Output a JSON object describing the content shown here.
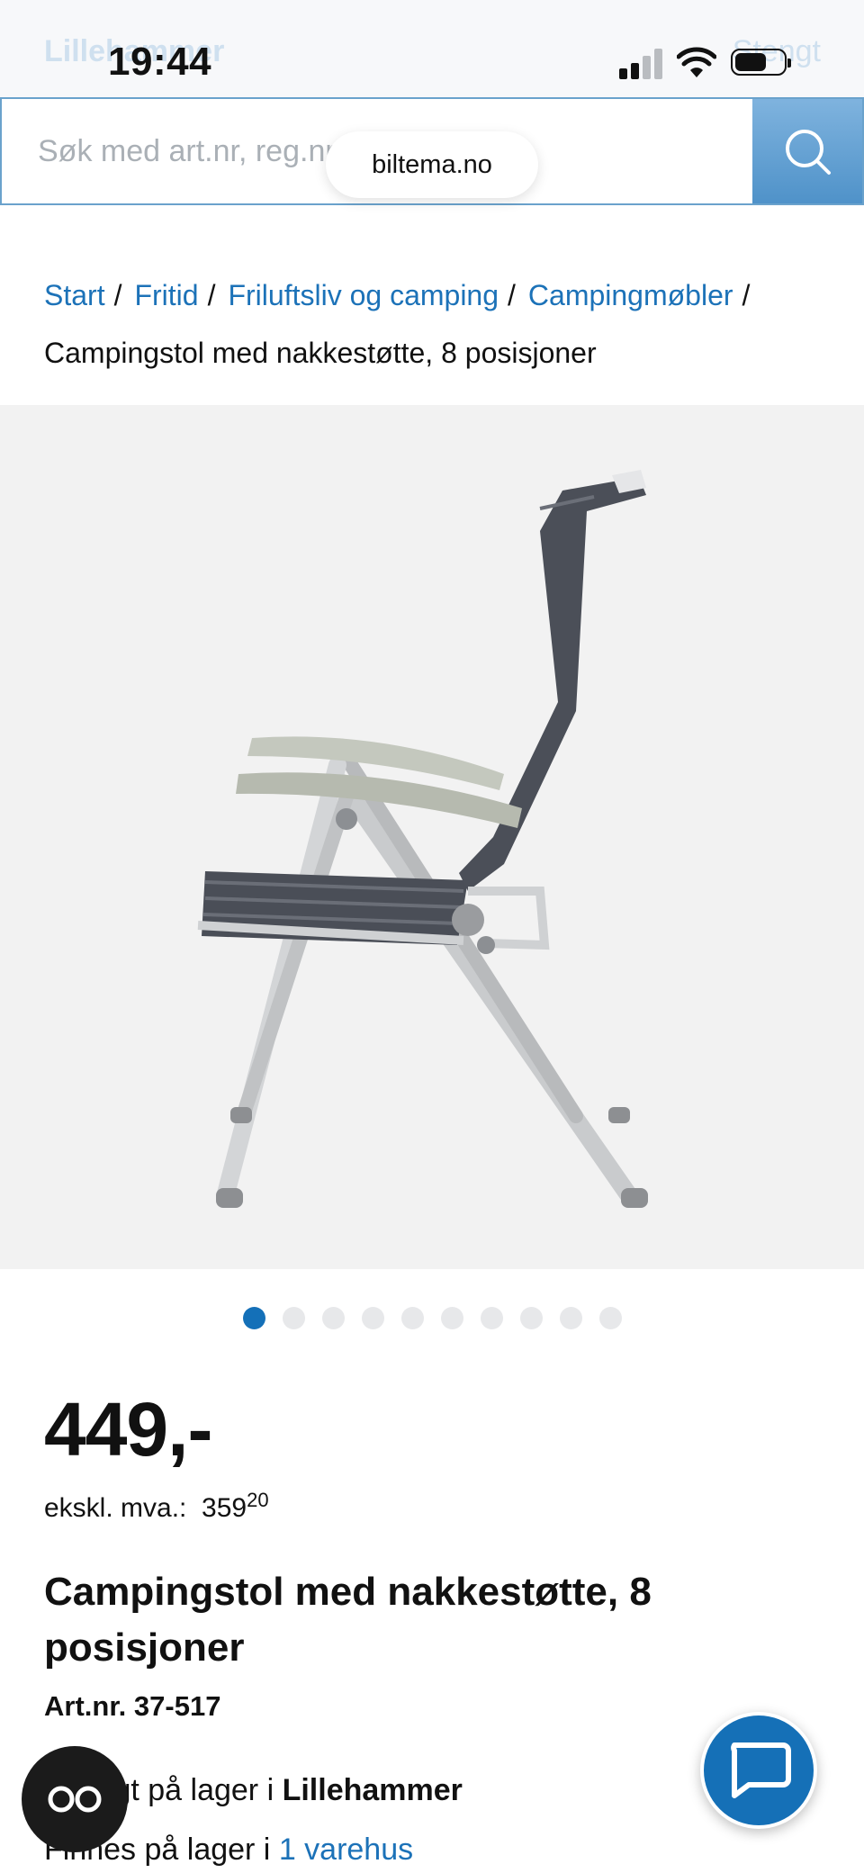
{
  "status_bar": {
    "time": "19:44"
  },
  "store_bar": {
    "store_name": "Lillehammer",
    "status": "Stengt"
  },
  "search": {
    "placeholder": "Søk med art.nr, reg.nr"
  },
  "browser": {
    "url": "biltema.no"
  },
  "breadcrumb": {
    "items": [
      "Start",
      "Fritid",
      "Friluftsliv og camping",
      "Campingmøbler"
    ],
    "separator": "/",
    "current": "Campingstol med nakkestøtte, 8 posisjoner"
  },
  "carousel": {
    "image_count": 10,
    "active_index": 0
  },
  "product": {
    "price": "449,-",
    "vat_label": "ekskl. mva.:",
    "vat_kr": "359",
    "vat_ore": "20",
    "title": "Campingstol med nakkestøtte, 8 posisjoner",
    "art_nr": "Art.nr. 37-517",
    "stock_prefix": "Utsolgt på lager i ",
    "stock_store": "Lillehammer",
    "avail_prefix": "Finnes på lager i ",
    "avail_link": "1 varehus"
  },
  "icons": {
    "search": "search-icon",
    "chat": "chat-icon",
    "reader": "glasses-icon"
  },
  "colors": {
    "brand_blue": "#1470b8",
    "link_blue": "#1c72b8",
    "text": "#111111"
  }
}
